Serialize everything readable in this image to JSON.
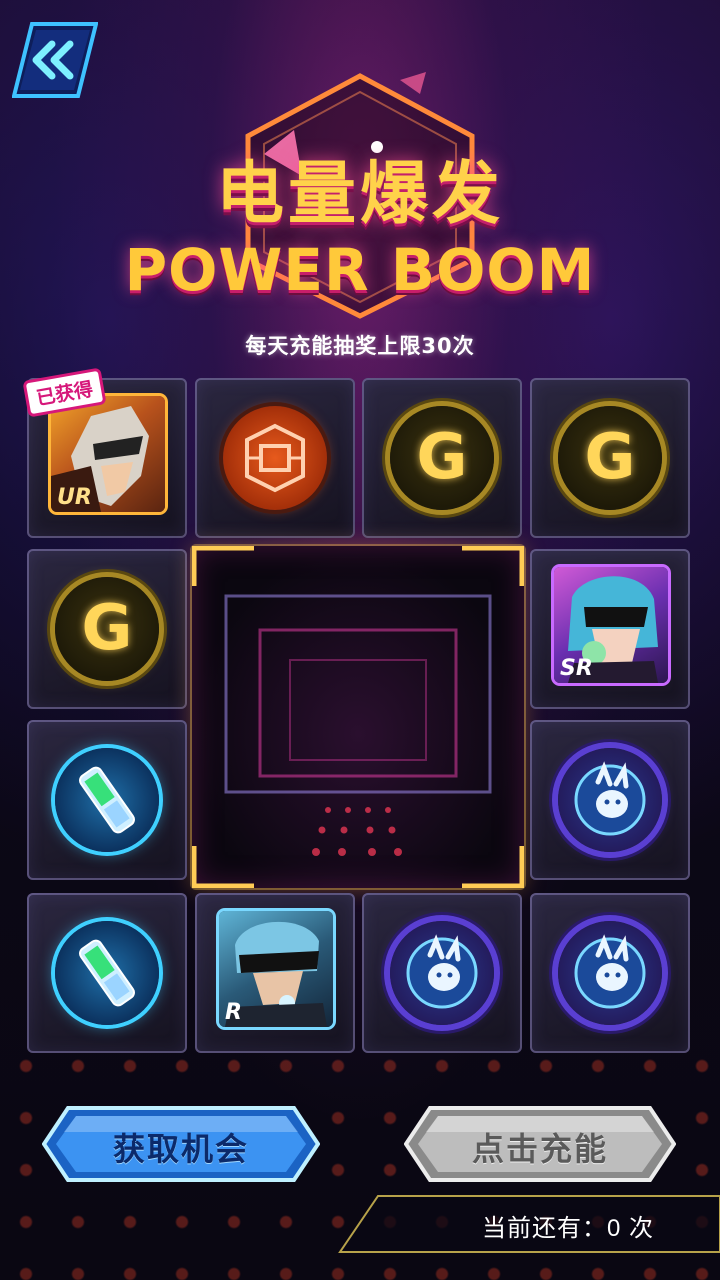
{
  "title_cn": "电量爆发",
  "title_en": "POWER BOOM",
  "subtitle": "每天充能抽奖上限30次",
  "grid": {
    "obtained_badge": "已获得",
    "rarity_ur": "UR",
    "rarity_sr": "SR",
    "rarity_r": "R",
    "coin_letter": "G"
  },
  "buttons": {
    "get_chance": "获取机会",
    "charge": "点击充能"
  },
  "remaining": {
    "label": "当前还有：",
    "count": "0",
    "unit": "次"
  },
  "colors": {
    "accent_gold": "#ffd24a",
    "accent_pink": "#c4206b",
    "button_blue": "#3fa7ff",
    "button_gray": "#b9b9b9"
  }
}
